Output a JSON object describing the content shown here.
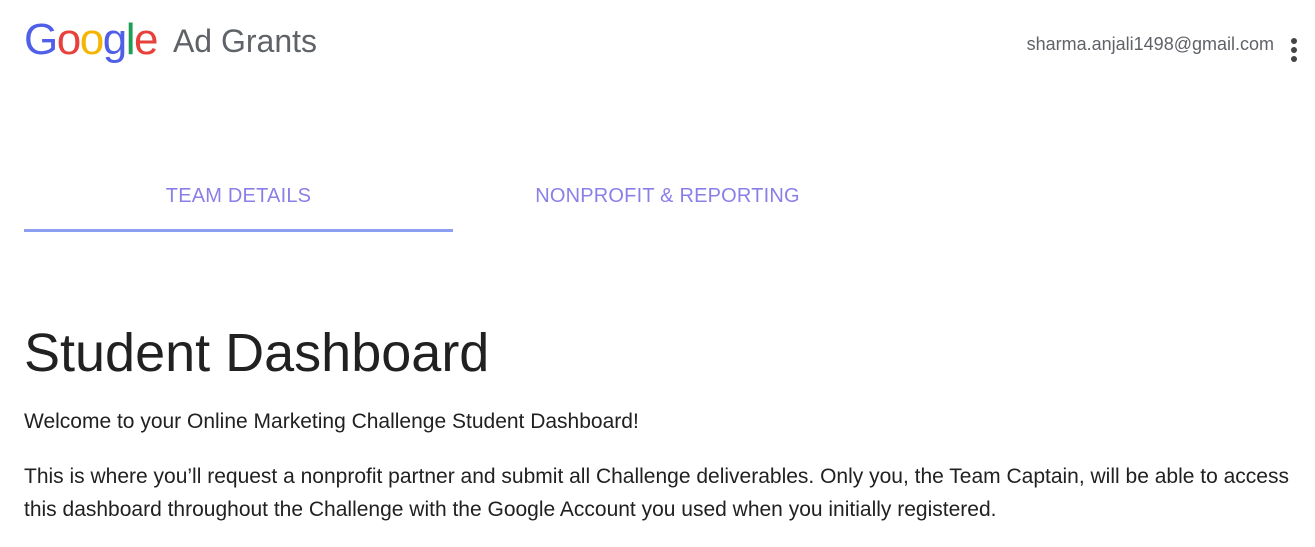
{
  "header": {
    "logo_letters": [
      {
        "char": "G",
        "color": "#4f5fe8"
      },
      {
        "char": "o",
        "color": "#e8403a"
      },
      {
        "char": "o",
        "color": "#f4b400"
      },
      {
        "char": "g",
        "color": "#4f5fe8"
      },
      {
        "char": "l",
        "color": "#1e9e55"
      },
      {
        "char": "e",
        "color": "#e8403a"
      }
    ],
    "product": "Ad Grants",
    "email": "sharma.anjali1498@gmail.com",
    "menu_icon": "more-vert-icon"
  },
  "tabs": [
    {
      "label": "TEAM DETAILS",
      "active": true
    },
    {
      "label": "NONPROFIT & REPORTING",
      "active": false
    }
  ],
  "colors": {
    "tab_text": "#8a7fe8",
    "tab_indicator": "#8c9ff0"
  },
  "main": {
    "title": "Student Dashboard",
    "paragraphs": [
      "Welcome to your Online Marketing Challenge Student Dashboard!",
      "This is where you’ll request a nonprofit partner and submit all Challenge deliverables. Only you, the Team Captain, will be able to access this dashboard throughout the Challenge with the Google Account you used when you initially registered."
    ]
  }
}
